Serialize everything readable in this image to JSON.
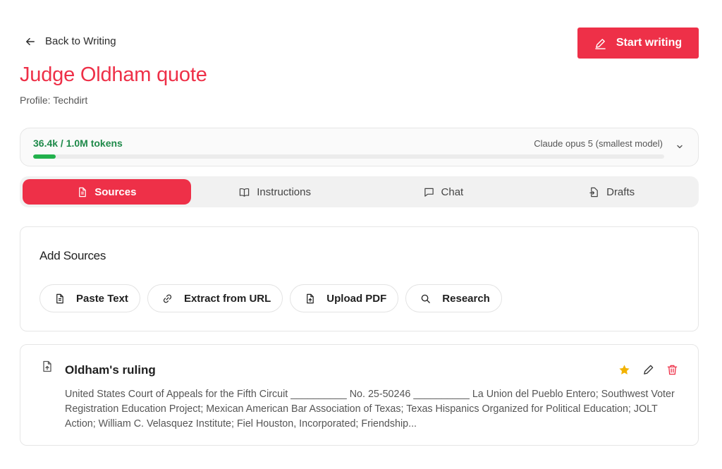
{
  "header": {
    "back_label": "Back to Writing",
    "start_label": "Start writing",
    "title": "Judge Oldham quote",
    "profile": "Profile: Techdirt"
  },
  "tokens": {
    "count_label": "36.4k / 1.0M tokens",
    "used_fraction": 0.036,
    "model_label": "Claude opus 5 (smallest model)"
  },
  "tabs": [
    {
      "label": "Sources",
      "icon": "document-icon",
      "active": true
    },
    {
      "label": "Instructions",
      "icon": "book-icon",
      "active": false
    },
    {
      "label": "Chat",
      "icon": "chat-icon",
      "active": false
    },
    {
      "label": "Drafts",
      "icon": "file-export-icon",
      "active": false
    }
  ],
  "add_sources": {
    "title": "Add Sources",
    "buttons": [
      {
        "label": "Paste Text",
        "icon": "document-icon"
      },
      {
        "label": "Extract from URL",
        "icon": "link-icon"
      },
      {
        "label": "Upload PDF",
        "icon": "upload-file-icon"
      },
      {
        "label": "Research",
        "icon": "search-icon"
      }
    ]
  },
  "source": {
    "title": "Oldham's ruling",
    "body": "United States Court of Appeals for the Fifth Circuit __________ No. 25-50246 __________ La Union del Pueblo Entero; Southwest Voter Registration Education Project; Mexican American Bar Association of Texas; Texas Hispanics Organized for Political Education; JOLT Action; William C. Velasquez Institute; Fiel Houston, Incorporated; Friendship...",
    "starred": true
  },
  "colors": {
    "accent": "#ee3048",
    "token_green": "#1f8a4a",
    "progress_green": "#22b14c",
    "star": "#f2b200"
  }
}
